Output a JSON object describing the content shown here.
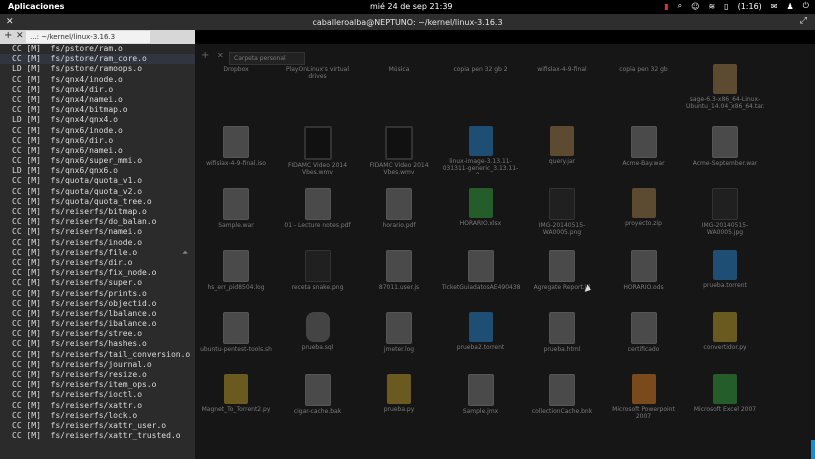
{
  "topbar": {
    "apps_label": "Aplicaciones",
    "clock": "mié 24 de sep 21:39",
    "battery": "(1:16)"
  },
  "window": {
    "title": "caballeroalba@NEPTUNO: ~/kernel/linux-3.16.3"
  },
  "terminal_tab": {
    "label": "...: ~/kernel/linux-3.16.3"
  },
  "terminal": {
    "lines": [
      "CC [M]  fs/pstore/ram.o",
      "CC [M]  fs/pstore/ram_core.o",
      "LD [M]  fs/pstore/ramoops.o",
      "CC [M]  fs/qnx4/inode.o",
      "CC [M]  fs/qnx4/dir.o",
      "CC [M]  fs/qnx4/namei.o",
      "CC [M]  fs/qnx4/bitmap.o",
      "LD [M]  fs/qnx4/qnx4.o",
      "CC [M]  fs/qnx6/inode.o",
      "CC [M]  fs/qnx6/dir.o",
      "CC [M]  fs/qnx6/namei.o",
      "CC [M]  fs/qnx6/super_mmi.o",
      "LD [M]  fs/qnx6/qnx6.o",
      "CC [M]  fs/quota/quota_v1.o",
      "CC [M]  fs/quota/quota_v2.o",
      "CC [M]  fs/quota/quota_tree.o",
      "CC [M]  fs/reiserfs/bitmap.o",
      "CC [M]  fs/reiserfs/do_balan.o",
      "CC [M]  fs/reiserfs/namei.o",
      "CC [M]  fs/reiserfs/inode.o",
      "CC [M]  fs/reiserfs/file.o",
      "CC [M]  fs/reiserfs/dir.o",
      "CC [M]  fs/reiserfs/fix_node.o",
      "CC [M]  fs/reiserfs/super.o",
      "CC [M]  fs/reiserfs/prints.o",
      "CC [M]  fs/reiserfs/objectid.o",
      "CC [M]  fs/reiserfs/lbalance.o",
      "CC [M]  fs/reiserfs/ibalance.o",
      "CC [M]  fs/reiserfs/stree.o",
      "CC [M]  fs/reiserfs/hashes.o",
      "CC [M]  fs/reiserfs/tail_conversion.o",
      "CC [M]  fs/reiserfs/journal.o",
      "CC [M]  fs/reiserfs/resize.o",
      "CC [M]  fs/reiserfs/item_ops.o",
      "CC [M]  fs/reiserfs/ioctl.o",
      "CC [M]  fs/reiserfs/xattr.o",
      "CC [M]  fs/reiserfs/lock.o",
      "CC [M]  fs/reiserfs/xattr_user.o",
      "CC [M]  fs/reiserfs/xattr_trusted.o"
    ]
  },
  "filemanager": {
    "tab_label": "Carpeta personal",
    "items": [
      {
        "name": "Dropbox",
        "icon": "folder"
      },
      {
        "name": "PlayOnLinux's virtual drives",
        "icon": "folder"
      },
      {
        "name": "Música",
        "icon": "folder"
      },
      {
        "name": "copia pen 32 gb 2",
        "icon": "folder"
      },
      {
        "name": "wifislax-4-9-final",
        "icon": "folder"
      },
      {
        "name": "copia pen 32 gb",
        "icon": "folder"
      },
      {
        "name": "sage-6.3-x86_64-Linux-Ubuntu_14.04_x86_64.tar.lzma",
        "icon": "pkg"
      },
      {
        "name": "wifislax-4-9-final.iso",
        "icon": "doc"
      },
      {
        "name": "FIDAMC Video 2014 Vbes.wmv",
        "icon": "video"
      },
      {
        "name": "FIDAMC Video 2014 Vbes.wmv",
        "icon": "video"
      },
      {
        "name": "linux-image-3.13.11-031311-generic_3.13.11-0...",
        "icon": "blue"
      },
      {
        "name": "query.jar",
        "icon": "pkg"
      },
      {
        "name": "Acme-Bay.war",
        "icon": "doc"
      },
      {
        "name": "Acme-September.war",
        "icon": "doc"
      },
      {
        "name": "Sample.war",
        "icon": "doc"
      },
      {
        "name": "01 - Lecture notes.pdf",
        "icon": "doc"
      },
      {
        "name": "horario.pdf",
        "icon": "doc"
      },
      {
        "name": "HORARIO.xlsx",
        "icon": "green"
      },
      {
        "name": "IMG-20140515-WA0005.png",
        "icon": "img"
      },
      {
        "name": "proyecto.zip",
        "icon": "pkg"
      },
      {
        "name": "IMG-20140515-WA0005.jpg",
        "icon": "img"
      },
      {
        "name": "hs_err_pid8504.log",
        "icon": "doc"
      },
      {
        "name": "receta snake.png",
        "icon": "img"
      },
      {
        "name": "87011.user.js",
        "icon": "doc"
      },
      {
        "name": "TicketGuiadatosAE49043888E.pdf",
        "icon": "doc"
      },
      {
        "name": "Agregate Report.jtl",
        "icon": "doc"
      },
      {
        "name": "HORARIO.ods",
        "icon": "doc"
      },
      {
        "name": "prueba.torrent",
        "icon": "blue"
      },
      {
        "name": "ubuntu-pentest-tools.sh",
        "icon": "doc"
      },
      {
        "name": "prueba.sql",
        "icon": "db"
      },
      {
        "name": "jmeter.log",
        "icon": "doc"
      },
      {
        "name": "prueba2.torrent",
        "icon": "blue"
      },
      {
        "name": "prueba.html",
        "icon": "doc"
      },
      {
        "name": "certificado",
        "icon": "doc"
      },
      {
        "name": "convertidor.py",
        "icon": "py"
      },
      {
        "name": "Magnet_To_Torrent2.py",
        "icon": "py"
      },
      {
        "name": "cigar-cache.bak",
        "icon": "doc"
      },
      {
        "name": "prueba.py",
        "icon": "py"
      },
      {
        "name": "Sample.jmx",
        "icon": "doc"
      },
      {
        "name": "collectionCache.bnk",
        "icon": "doc"
      },
      {
        "name": "Microsoft Powerpoint 2007",
        "icon": "orange"
      },
      {
        "name": "Microsoft Excel 2007",
        "icon": "green"
      }
    ]
  }
}
